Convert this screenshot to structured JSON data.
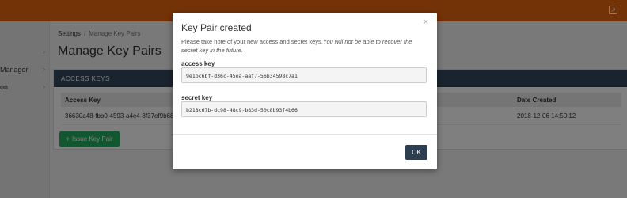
{
  "topbar": {
    "icon": "external-link-icon"
  },
  "sidebar": {
    "items": [
      {
        "label": ""
      },
      {
        "label": "Manager"
      },
      {
        "label": "on"
      }
    ]
  },
  "breadcrumb": {
    "root": "Settings",
    "current": "Manage Key Pairs"
  },
  "page": {
    "title": "Manage Key Pairs"
  },
  "panel": {
    "heading": "ACCESS KEYS",
    "columns": [
      "Access Key",
      "Date Created"
    ],
    "rows": [
      {
        "access_key": "36630a48-fbb0-4593-a4e4-8f37ef9b6821",
        "date_created": "2018-12-06 14:50:12"
      }
    ],
    "issue_button": "Issue Key Pair"
  },
  "modal": {
    "title": "Key Pair created",
    "close": "×",
    "message_plain": "Please take note of your new access and secret keys.",
    "message_italic": "You will not be able to recover the secret key in the future.",
    "access_label": "access key",
    "access_value": "9e1bc6bf-d36c-45ea-aaf7-56b34598c7a1",
    "secret_label": "secret key",
    "secret_value": "b218c67b-dc98-48c9-b83d-50c8b93f4b66",
    "ok_label": "OK"
  }
}
